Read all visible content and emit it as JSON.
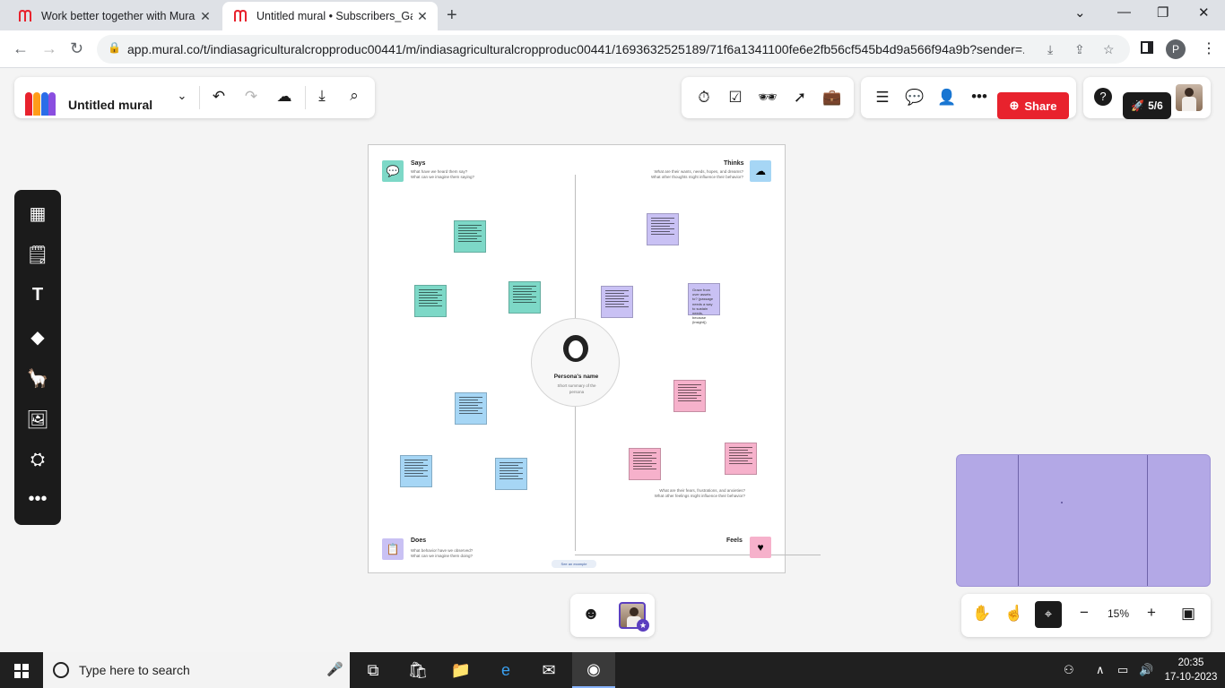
{
  "browser": {
    "tabs": [
      {
        "title": "Work better together with Mural",
        "active": false
      },
      {
        "title": "Untitled mural • Subscribers_Gal",
        "active": true
      }
    ],
    "url": "app.mural.co/t/indiasagriculturalcropproduc00441/m/indiasagriculturalcropproduc00441/1693632525189/71f6a1341100fe6e2fb56cf545b4d9a566f94a9b?sender=...",
    "profile_initial": "P"
  },
  "toolbar": {
    "mural_title": "Untitled mural",
    "share_label": "Share",
    "counter": "5/6"
  },
  "board": {
    "says": {
      "title": "Says",
      "line1": "What have we heard them say?",
      "line2": "What can we imagine them saying?"
    },
    "thinks": {
      "title": "Thinks",
      "line1": "What are their wants, needs, hopes, and dreams?",
      "line2": "What other thoughts might influence their behavior?"
    },
    "does": {
      "title": "Does",
      "line1": "What behavior have we observed?",
      "line2": "What can we imagine them doing?"
    },
    "feels": {
      "title": "Feels",
      "line1": "What are their fears, frustrations, and anxieties?",
      "line2": "What other feelings might influence their behavior?"
    },
    "persona_name": "Persona's name",
    "persona_summary": "Short summary of the persona",
    "example_link": "See an example",
    "thinks_note_text": "Graze from over assets to? (passage needs a way to sustain needs, because (insight))"
  },
  "zoom": {
    "level": "15%"
  },
  "taskbar": {
    "search_placeholder": "Type here to search",
    "time": "20:35",
    "date": "17-10-2023"
  },
  "colors": {
    "share": "#e8222d",
    "note_teal": "#7dd8c7",
    "note_purple": "#c9c1f4",
    "note_blue": "#a6d6f5",
    "note_pink": "#f6b1cb",
    "minimap": "#b3a8e6"
  }
}
